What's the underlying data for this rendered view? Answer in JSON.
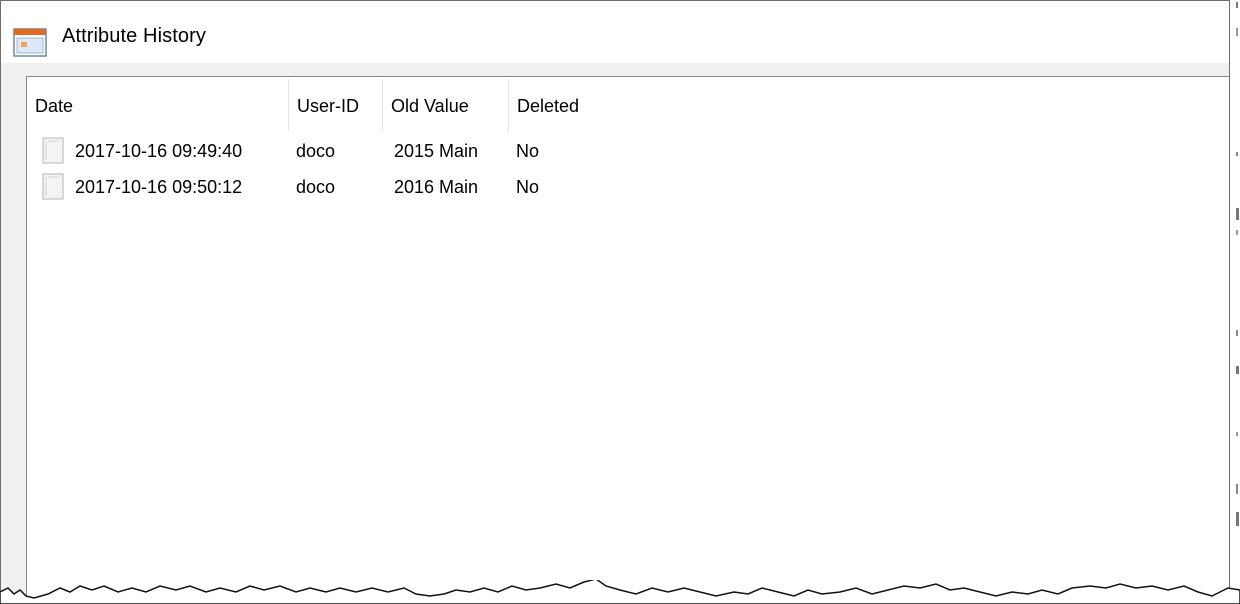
{
  "window": {
    "title": "Attribute History",
    "icon": "window-app-icon"
  },
  "listview": {
    "columns": [
      {
        "key": "date",
        "label": "Date"
      },
      {
        "key": "user",
        "label": "User-ID"
      },
      {
        "key": "old_value",
        "label": "Old Value"
      },
      {
        "key": "deleted",
        "label": "Deleted"
      }
    ],
    "rows": [
      {
        "icon": "document-icon",
        "date": "2017-10-16 09:49:40",
        "user": "doco",
        "old_value": "2015 Main",
        "deleted": "No"
      },
      {
        "icon": "document-icon",
        "date": "2017-10-16 09:50:12",
        "user": "doco",
        "old_value": "2016 Main",
        "deleted": "No"
      }
    ]
  },
  "colors": {
    "titlebar_bg": "#ffffff",
    "client_bg": "#f0f0f0",
    "list_border": "#828790",
    "icon_accent": "#e26a1f"
  }
}
